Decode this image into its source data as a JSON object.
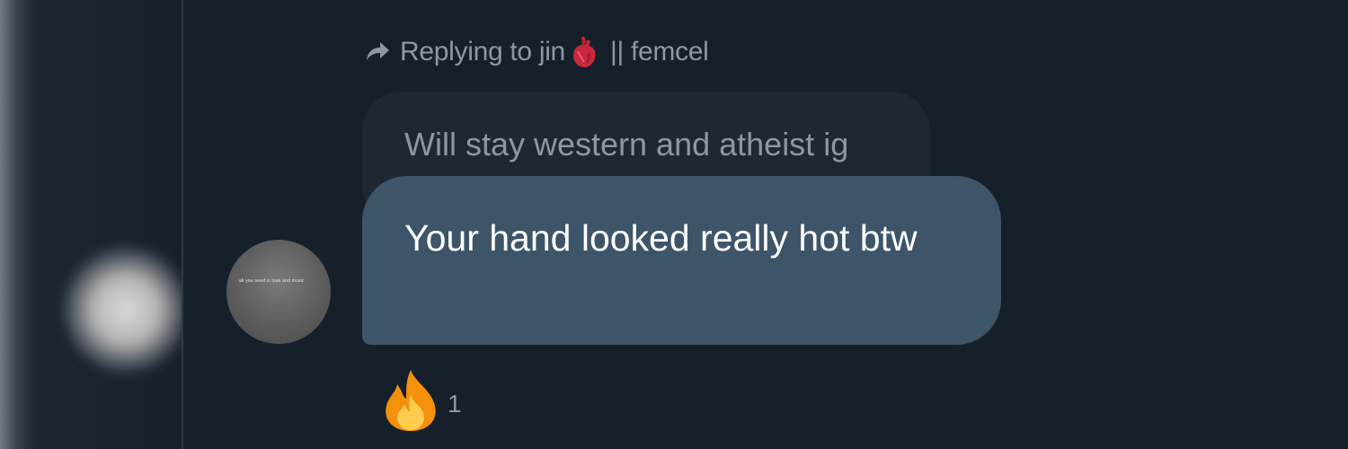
{
  "reply": {
    "prefix": "Replying to jin",
    "suffix": "|| femcel",
    "reply_icon": "reply-arrow-icon",
    "emoji": "anatomical-heart-icon"
  },
  "quoted_message": {
    "text": "Will stay western and atheist ig"
  },
  "message": {
    "text": "Your hand looked really hot btw"
  },
  "reaction": {
    "emoji": "fire-icon",
    "count": "1"
  },
  "colors": {
    "background": "#15202b",
    "bubble": "#3e5569",
    "quoted_bubble": "#1e2732",
    "muted_text": "#8b98a5"
  }
}
